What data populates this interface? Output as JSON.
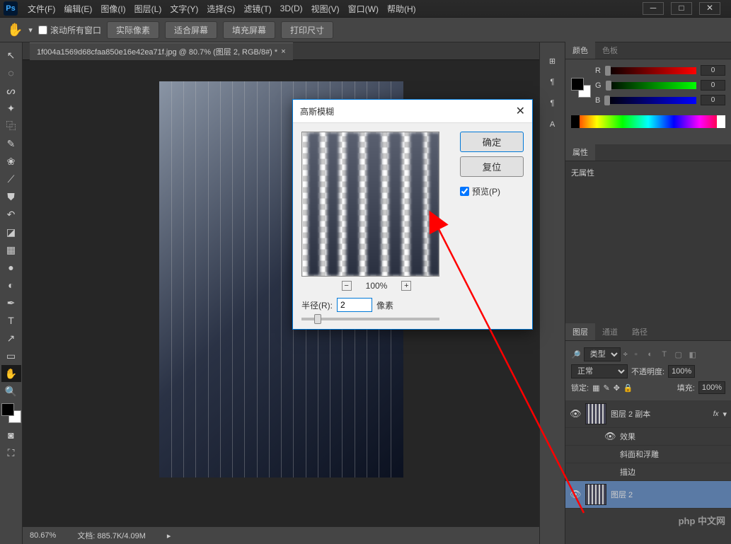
{
  "app": {
    "logo": "Ps"
  },
  "menu": {
    "file": "文件(F)",
    "edit": "编辑(E)",
    "image": "图像(I)",
    "layer": "图层(L)",
    "text": "文字(Y)",
    "select": "选择(S)",
    "filter": "滤镜(T)",
    "3d": "3D(D)",
    "view": "视图(V)",
    "window": "窗口(W)",
    "help": "帮助(H)"
  },
  "options": {
    "scroll_all": "滚动所有窗口",
    "actual_pixels": "实际像素",
    "fit_screen": "适合屏幕",
    "fill_screen": "填充屏幕",
    "print_size": "打印尺寸"
  },
  "doc_tab": "1f004a1569d68cfaa850e16e42ea71f.jpg @ 80.7% (图层 2, RGB/8#) *",
  "dialog": {
    "title": "高斯模糊",
    "ok": "确定",
    "reset": "复位",
    "preview": "预览(P)",
    "zoom": "100%",
    "radius_label": "半径(R):",
    "radius_value": "2",
    "radius_unit": "像素"
  },
  "color_panel": {
    "tab_color": "颜色",
    "tab_swatch": "色板",
    "r_label": "R",
    "g_label": "G",
    "b_label": "B",
    "r_val": "0",
    "g_val": "0",
    "b_val": "0"
  },
  "properties_panel": {
    "tab": "属性",
    "no_props": "无属性"
  },
  "layers_panel": {
    "tab_layers": "图层",
    "tab_channels": "通道",
    "tab_paths": "路径",
    "type_label": "类型",
    "blend_mode": "正常",
    "opacity_label": "不透明度:",
    "opacity_val": "100%",
    "lock_label": "锁定:",
    "fill_label": "填充:",
    "fill_val": "100%",
    "layers": [
      {
        "name": "图层 2 副本",
        "fx": "fx",
        "visible": true
      },
      {
        "name": "效果",
        "sub": true,
        "visible": true
      },
      {
        "name": "斜面和浮雕",
        "sub": true,
        "visible": false
      },
      {
        "name": "描边",
        "sub": true,
        "visible": false
      },
      {
        "name": "图层 2",
        "visible": true,
        "selected": true
      }
    ]
  },
  "status": {
    "zoom": "80.67%",
    "doc_size": "文档: 885.7K/4.09M"
  },
  "watermark": "php 中文网"
}
